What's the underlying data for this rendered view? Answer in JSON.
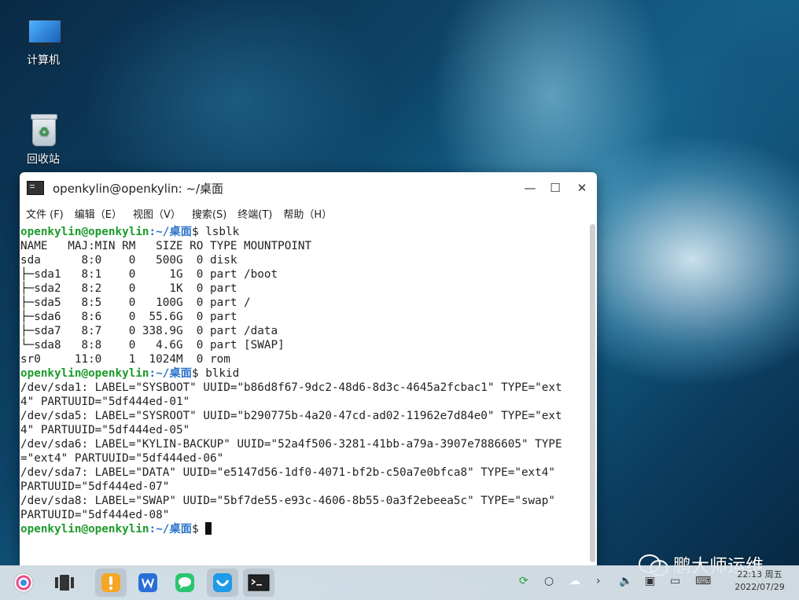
{
  "desktop": {
    "icons": [
      {
        "label": "计算机",
        "icon": "computer-icon"
      },
      {
        "label": "回收站",
        "icon": "recycle-bin-icon"
      }
    ]
  },
  "window": {
    "title": "openkylin@openkylin: ~/桌面",
    "controls": {
      "minimize": "—",
      "maximize": "☐",
      "close": "✕"
    },
    "menu": [
      "文件 (F)",
      "编辑（E）",
      "视图（V）",
      "搜索(S)",
      "终端(T)",
      "帮助（H）"
    ]
  },
  "terminal": {
    "prompt_user": "openkylin@openkylin",
    "prompt_path": ":~/桌面",
    "prompt_symbol": "$ ",
    "cmd1": "lsblk",
    "lsblk_output": "NAME   MAJ:MIN RM   SIZE RO TYPE MOUNTPOINT\nsda      8:0    0   500G  0 disk\n├─sda1   8:1    0     1G  0 part /boot\n├─sda2   8:2    0     1K  0 part\n├─sda5   8:5    0   100G  0 part /\n├─sda6   8:6    0  55.6G  0 part\n├─sda7   8:7    0 338.9G  0 part /data\n└─sda8   8:8    0   4.6G  0 part [SWAP]\nsr0     11:0    1  1024M  0 rom",
    "cmd2": "blkid",
    "blkid_output": "/dev/sda1: LABEL=\"SYSBOOT\" UUID=\"b86d8f67-9dc2-48d6-8d3c-4645a2fcbac1\" TYPE=\"ext\n4\" PARTUUID=\"5df444ed-01\"\n/dev/sda5: LABEL=\"SYSROOT\" UUID=\"b290775b-4a20-47cd-ad02-11962e7d84e0\" TYPE=\"ext\n4\" PARTUUID=\"5df444ed-05\"\n/dev/sda6: LABEL=\"KYLIN-BACKUP\" UUID=\"52a4f506-3281-41bb-a79a-3907e7886605\" TYPE\n=\"ext4\" PARTUUID=\"5df444ed-06\"\n/dev/sda7: LABEL=\"DATA\" UUID=\"e5147d56-1df0-4071-bf2b-c50a7e0bfca8\" TYPE=\"ext4\"\nPARTUUID=\"5df444ed-07\"\n/dev/sda8: LABEL=\"SWAP\" UUID=\"5bf7de55-e93c-4606-8b55-0a3f2ebeea5c\" TYPE=\"swap\"\nPARTUUID=\"5df444ed-08\""
  },
  "taskbar": {
    "clock_time": "22:13 周五",
    "clock_date": "2022/07/29"
  },
  "watermark": {
    "text": "鹏大师运维"
  }
}
